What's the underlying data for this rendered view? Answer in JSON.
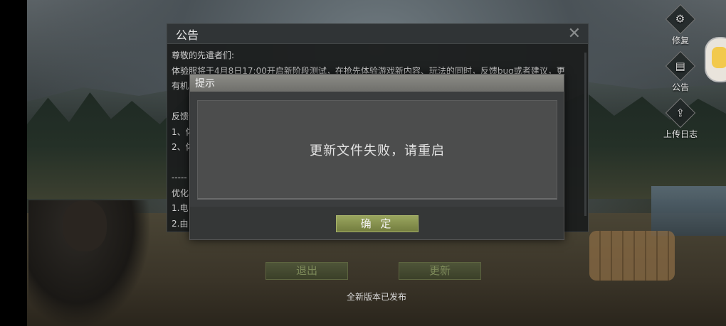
{
  "side_buttons": [
    {
      "label": "修复",
      "icon": "repair-gears-icon",
      "glyph": "⚙"
    },
    {
      "label": "公告",
      "icon": "notice-clipboard-icon",
      "glyph": "▤"
    },
    {
      "label": "上传日志",
      "icon": "upload-icon",
      "glyph": "⇪"
    }
  ],
  "announcement": {
    "title": "公告",
    "lines": [
      "尊敬的先遣者们:",
      "体验服将于4月8日17:00开启新阶段测试，在抢先体验游戏新内容、玩法的同时，反馈bug或者建议，更",
      "有机",
      "",
      "反馈",
      "1、体",
      "2、体",
      "",
      "-----",
      "优化",
      "1.电",
      "2.由"
    ]
  },
  "footer_buttons": {
    "exit_label": "退出",
    "update_label": "更新"
  },
  "release_note": "全新版本已发布",
  "dialog": {
    "title": "提示",
    "message": "更新文件失败，请重启",
    "confirm_label": "确 定"
  }
}
